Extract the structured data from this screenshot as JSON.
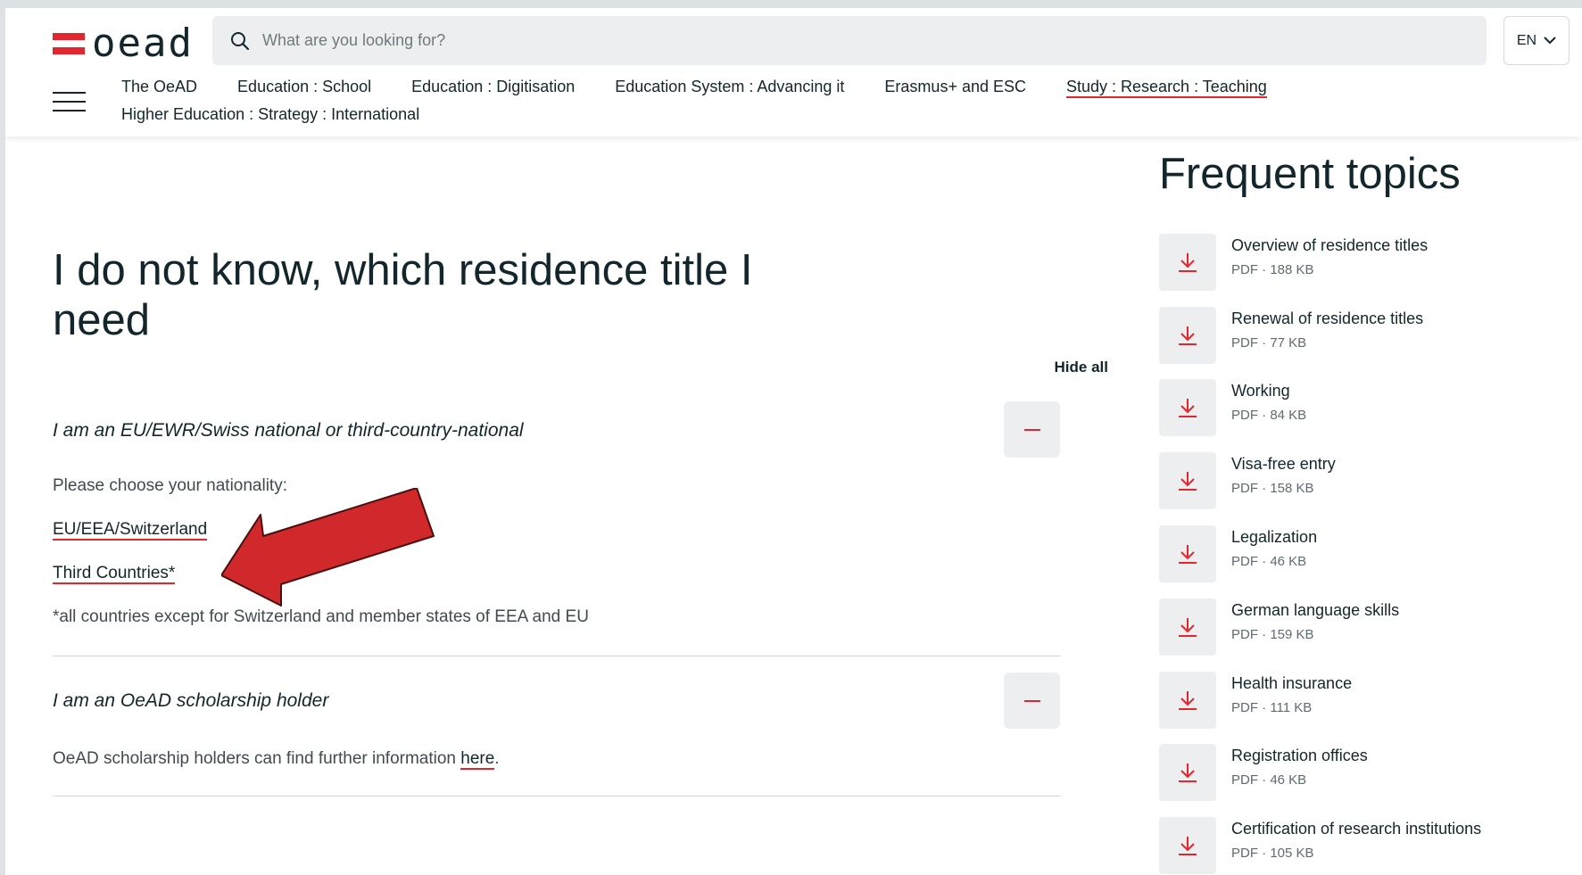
{
  "header": {
    "logo_text": "oead",
    "search_placeholder": "What are you looking for?",
    "language": "EN",
    "nav": [
      {
        "label": "The OeAD"
      },
      {
        "label": "Education : School"
      },
      {
        "label": "Education : Digitisation"
      },
      {
        "label": "Education System : Advancing it"
      },
      {
        "label": "Erasmus+ and ESC"
      },
      {
        "label": "Study : Research : Teaching",
        "active": true
      },
      {
        "label": "Higher Education : Strategy : International"
      }
    ]
  },
  "main": {
    "title": "I do not know, which residence title I need",
    "hide_all": "Hide all",
    "accordion": [
      {
        "question": "I am an EU/EWR/Swiss national or third-country-national",
        "prompt": "Please choose your nationality:",
        "links": [
          "EU/EEA/Switzerland",
          "Third Countries*"
        ],
        "note": "*all countries except for Switzerland and member states of EEA and EU"
      },
      {
        "question": "I am an OeAD scholarship holder",
        "text_before": "OeAD scholarship holders can find further information ",
        "link": "here",
        "text_after": "."
      }
    ]
  },
  "sidebar": {
    "title": "Frequent topics",
    "items": [
      {
        "name": "Overview of residence titles",
        "meta": "PDF · 188 KB"
      },
      {
        "name": "Renewal of residence titles",
        "meta": "PDF · 77 KB"
      },
      {
        "name": "Working",
        "meta": "PDF · 84 KB"
      },
      {
        "name": "Visa-free entry",
        "meta": "PDF · 158 KB"
      },
      {
        "name": "Legalization",
        "meta": "PDF · 46 KB"
      },
      {
        "name": "German language skills",
        "meta": "PDF · 159 KB"
      },
      {
        "name": "Health insurance",
        "meta": "PDF · 111 KB"
      },
      {
        "name": "Registration offices",
        "meta": "PDF · 46 KB"
      },
      {
        "name": "Certification of research institutions",
        "meta": "PDF · 105 KB"
      }
    ]
  },
  "colors": {
    "accent": "#e3262e",
    "text": "#12262b",
    "button_bg": "#eceeef",
    "annotation_arrow": "#d1282b"
  }
}
